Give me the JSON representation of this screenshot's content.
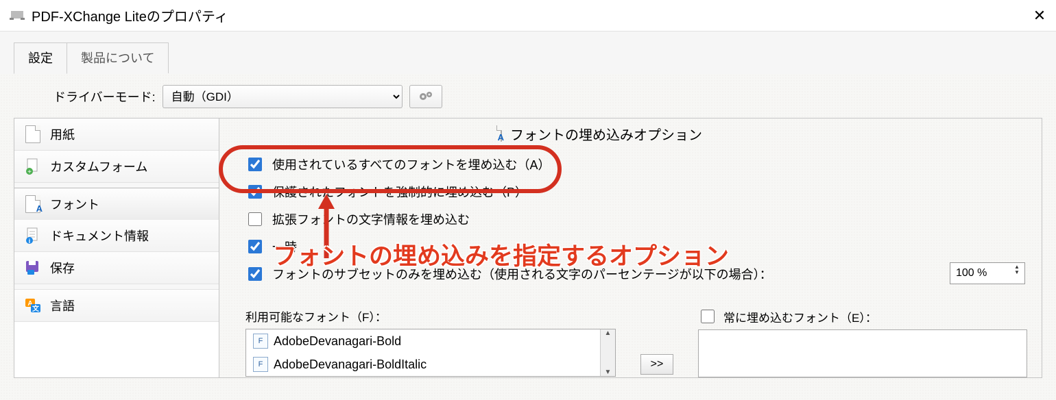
{
  "window": {
    "title": "PDF-XChange Liteのプロパティ"
  },
  "tabs": {
    "settings": "設定",
    "about": "製品について"
  },
  "driver": {
    "label": "ドライバーモード:",
    "value": "自動（GDI）"
  },
  "sidebar": {
    "paper": "用紙",
    "custom_forms": "カスタムフォーム",
    "fonts": "フォント",
    "doc_info": "ドキュメント情報",
    "save": "保存",
    "language": "言語"
  },
  "main": {
    "header": "フォントの埋め込みオプション",
    "check_embed_all": "使用されているすべてのフォントを埋め込む（A）",
    "check_force_protected": "保護されたフォントを強制的に埋め込む（P）",
    "check_extended_info": "拡張フォントの文字情報を埋め込む",
    "check_temp_partial": "一時",
    "check_subset": "フォントのサブセットのみを埋め込む（使用される文字のパーセンテージが以下の場合）：",
    "subset_percent": "100 %",
    "available_fonts_label": "利用可能なフォント（F）：",
    "available_fonts": [
      "AdobeDevanagari-Bold",
      "AdobeDevanagari-BoldItalic"
    ],
    "always_embed_label": "常に埋め込むフォント（E）：",
    "move_right": ">>"
  },
  "annotation": {
    "text": "フォントの埋め込みを指定するオプション"
  },
  "states": {
    "embed_all": true,
    "force_protected": true,
    "extended_info": false,
    "temp": true,
    "subset": true,
    "always_embed_header": false
  }
}
